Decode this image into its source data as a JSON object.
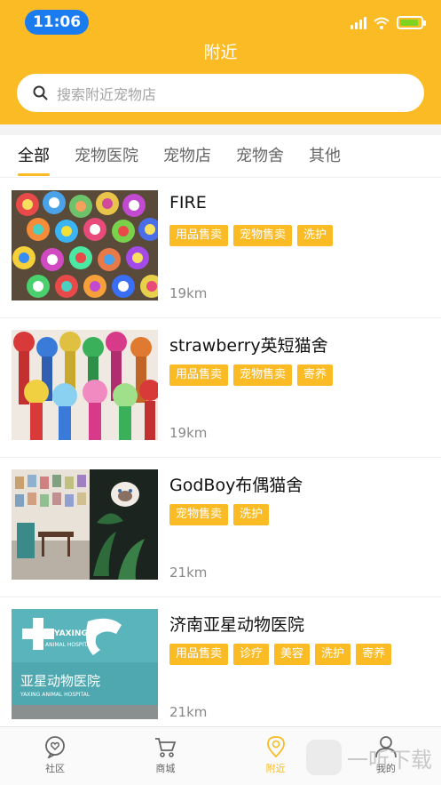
{
  "status": {
    "time": "11:06"
  },
  "header": {
    "title": "附近"
  },
  "search": {
    "placeholder": "搜索附近宠物店"
  },
  "tabs": [
    {
      "label": "全部",
      "active": true
    },
    {
      "label": "宠物医院",
      "active": false
    },
    {
      "label": "宠物店",
      "active": false
    },
    {
      "label": "宠物舍",
      "active": false
    },
    {
      "label": "其他",
      "active": false
    }
  ],
  "stores": [
    {
      "name": "FIRE",
      "tags": [
        "用品售卖",
        "宠物售卖",
        "洗护"
      ],
      "distance": "19km"
    },
    {
      "name": "strawberry英短猫舍",
      "tags": [
        "用品售卖",
        "宠物售卖",
        "寄养"
      ],
      "distance": "19km"
    },
    {
      "name": "GodBoy布偶猫舍",
      "tags": [
        "宠物售卖",
        "洗护"
      ],
      "distance": "21km"
    },
    {
      "name": "济南亚星动物医院",
      "tags": [
        "用品售卖",
        "诊疗",
        "美容",
        "洗护",
        "寄养"
      ],
      "distance": "21km"
    }
  ],
  "hospital_sign": {
    "line1": "YAXING",
    "line2": "ANIMAL HOSPITAL",
    "cn": "亚星动物医院",
    "en": "YAXING ANIMAL HOSPITAL"
  },
  "tabbar": [
    {
      "label": "社区",
      "icon": "community-icon",
      "active": false
    },
    {
      "label": "商城",
      "icon": "cart-icon",
      "active": false
    },
    {
      "label": "附近",
      "icon": "location-icon",
      "active": true
    },
    {
      "label": "我的",
      "icon": "profile-icon",
      "active": false
    }
  ],
  "watermark": {
    "text": "一听下载"
  },
  "colors": {
    "accent": "#fbbb25",
    "status_pill": "#1b7cf0"
  }
}
